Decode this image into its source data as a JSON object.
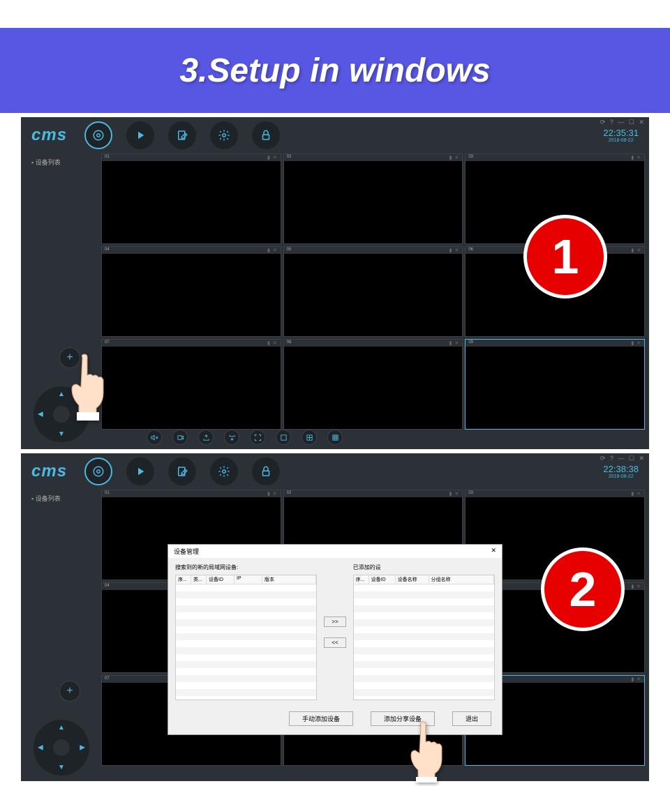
{
  "banner": {
    "title": "3.Setup in windows"
  },
  "app": {
    "logo": "cms",
    "sidebar_label": "设备列表",
    "win_controls": "⟳ ? — ☐ ✕",
    "nav": [
      "video",
      "play",
      "edit",
      "settings",
      "lock"
    ]
  },
  "clock1": {
    "time": "22:35:31",
    "date": "2018-08-22"
  },
  "clock2": {
    "time": "22:38:38",
    "date": "2018-08-22"
  },
  "cells": [
    "01",
    "02",
    "03",
    "04",
    "05",
    "06",
    "07",
    "08",
    "09"
  ],
  "toolbar": [
    "mute",
    "record",
    "snap",
    "export",
    "full",
    "single",
    "grid4",
    "grid9"
  ],
  "badge1": "1",
  "badge2": "2",
  "dialog": {
    "title": "设备管理",
    "left_label": "搜索到的新的局域网设备:",
    "right_label": "已添加的设",
    "left_headers": [
      "序...",
      "类...",
      "设备ID",
      "IP",
      "版本"
    ],
    "right_headers": [
      "序...",
      "设备ID",
      "设备名称",
      "分组名称"
    ],
    "move_right": ">>",
    "move_left": "<<",
    "btn_manual": "手动添加设备",
    "btn_share": "添加分享设备",
    "btn_exit": "退出"
  }
}
